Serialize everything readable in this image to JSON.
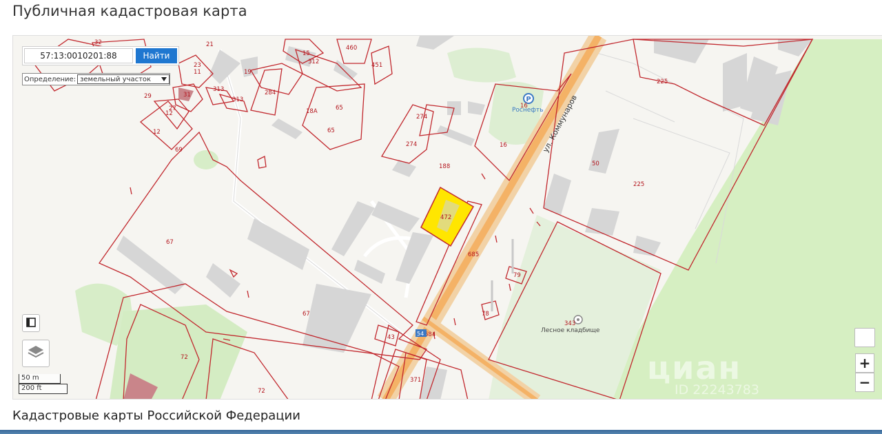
{
  "page": {
    "title": "Публичная кадастровая карта",
    "section_title": "Кадастровые карты Российской Федерации"
  },
  "search": {
    "value": "57:13:0010201:88",
    "button_label": "Найти"
  },
  "definition": {
    "label": "Определение:",
    "selected": "земельный участок"
  },
  "scale": {
    "metric": "50 m",
    "imperial": "200 ft"
  },
  "zoom": {
    "in_label": "+",
    "out_label": "−"
  },
  "map": {
    "street_label": "ул. Коммунаров",
    "poi": {
      "rosneft": "Роснефть",
      "cemetery": "Лесное кладбище"
    },
    "parcel_labels": [
      "21",
      "32",
      "15",
      "312",
      "460",
      "451",
      "23",
      "11",
      "19",
      "284",
      "313",
      "313",
      "31",
      "29",
      "27",
      "12",
      "12",
      "69",
      "18А",
      "65",
      "65",
      "274",
      "274",
      "16",
      "16",
      "188",
      "225",
      "50",
      "225",
      "472",
      "67",
      "685",
      "79",
      "67",
      "78",
      "343",
      "43",
      "684",
      "72",
      "72",
      "371"
    ],
    "highlight_color": "#ffe600",
    "parcel_border_color": "#c1272d",
    "road_color": "#f4b266",
    "forest_color": "#d7f0c4"
  },
  "watermark": {
    "brand": "циан",
    "phone": "ID 22243783"
  }
}
